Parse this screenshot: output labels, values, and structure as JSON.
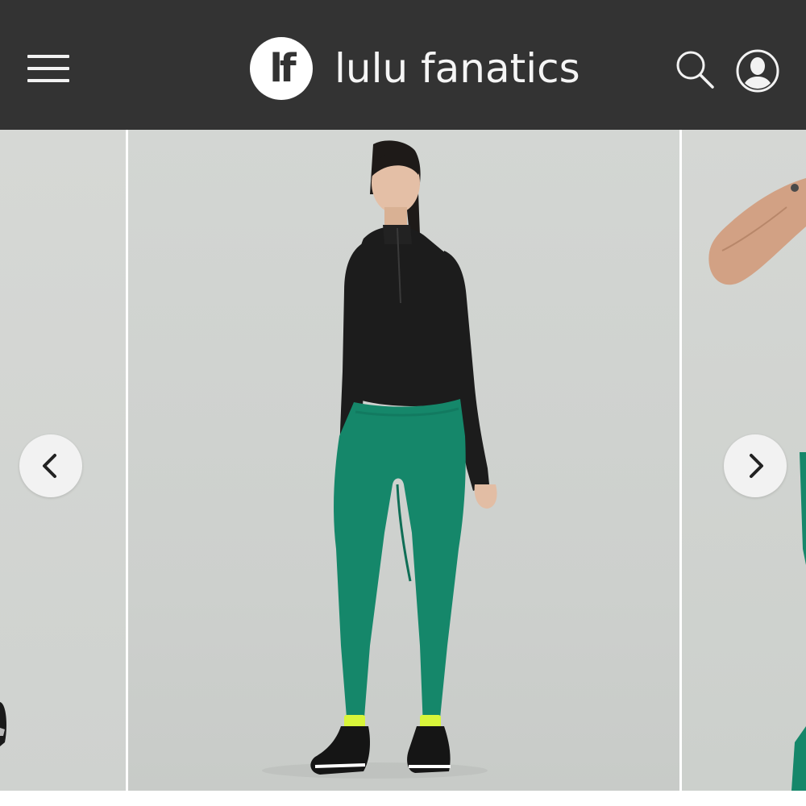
{
  "header": {
    "menu_icon": "hamburger-menu-icon",
    "logo_mark": "lf",
    "brand_name": "lulu fanatics",
    "search_icon": "search-icon",
    "account_icon": "user-account-icon",
    "background_color": "#333333"
  },
  "carousel": {
    "prev_icon": "chevron-left-icon",
    "next_icon": "chevron-right-icon",
    "slides": [
      {
        "position": "previous",
        "description_icon": "product-photo"
      },
      {
        "position": "current",
        "description_icon": "product-photo"
      },
      {
        "position": "next",
        "description_icon": "product-photo"
      }
    ]
  },
  "colors": {
    "legging_green": "#15876a",
    "top_black": "#1c1c1c",
    "sock_neon": "#d8f53a",
    "backdrop_gray": "#d0d3d0"
  }
}
